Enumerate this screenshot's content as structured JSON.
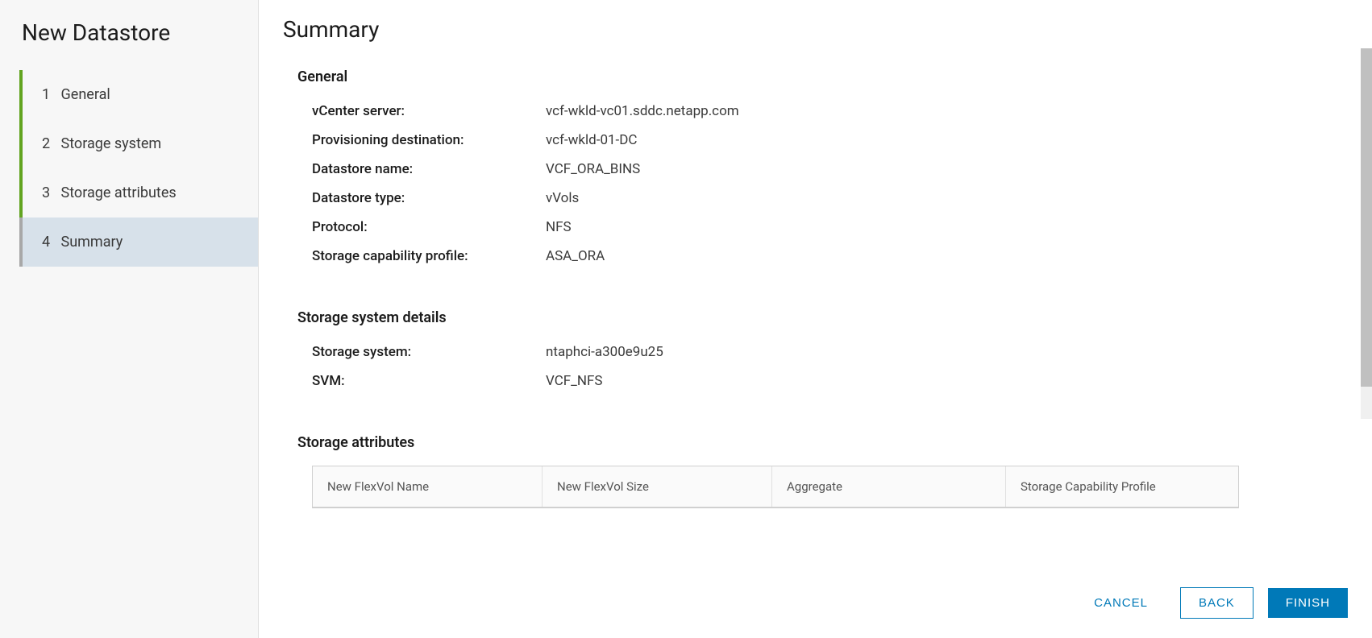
{
  "sidebar": {
    "title": "New Datastore",
    "steps": [
      {
        "num": "1",
        "label": "General"
      },
      {
        "num": "2",
        "label": "Storage system"
      },
      {
        "num": "3",
        "label": "Storage attributes"
      },
      {
        "num": "4",
        "label": "Summary"
      }
    ]
  },
  "main": {
    "title": "Summary",
    "sections": {
      "general": {
        "title": "General",
        "fields": {
          "vcenter_label": "vCenter server:",
          "vcenter_value": "vcf-wkld-vc01.sddc.netapp.com",
          "provdest_label": "Provisioning destination:",
          "provdest_value": "vcf-wkld-01-DC",
          "dsname_label": "Datastore name:",
          "dsname_value": "VCF_ORA_BINS",
          "dstype_label": "Datastore type:",
          "dstype_value": "vVols",
          "protocol_label": "Protocol:",
          "protocol_value": "NFS",
          "scp_label": "Storage capability profile:",
          "scp_value": "ASA_ORA"
        }
      },
      "storage_system": {
        "title": "Storage system details",
        "fields": {
          "system_label": "Storage system:",
          "system_value": "ntaphci-a300e9u25",
          "svm_label": "SVM:",
          "svm_value": "VCF_NFS"
        }
      },
      "storage_attributes": {
        "title": "Storage attributes",
        "columns": {
          "col1": "New FlexVol Name",
          "col2": "New FlexVol Size",
          "col3": "Aggregate",
          "col4": "Storage Capability Profile"
        }
      }
    }
  },
  "footer": {
    "cancel": "CANCEL",
    "back": "BACK",
    "finish": "FINISH"
  }
}
